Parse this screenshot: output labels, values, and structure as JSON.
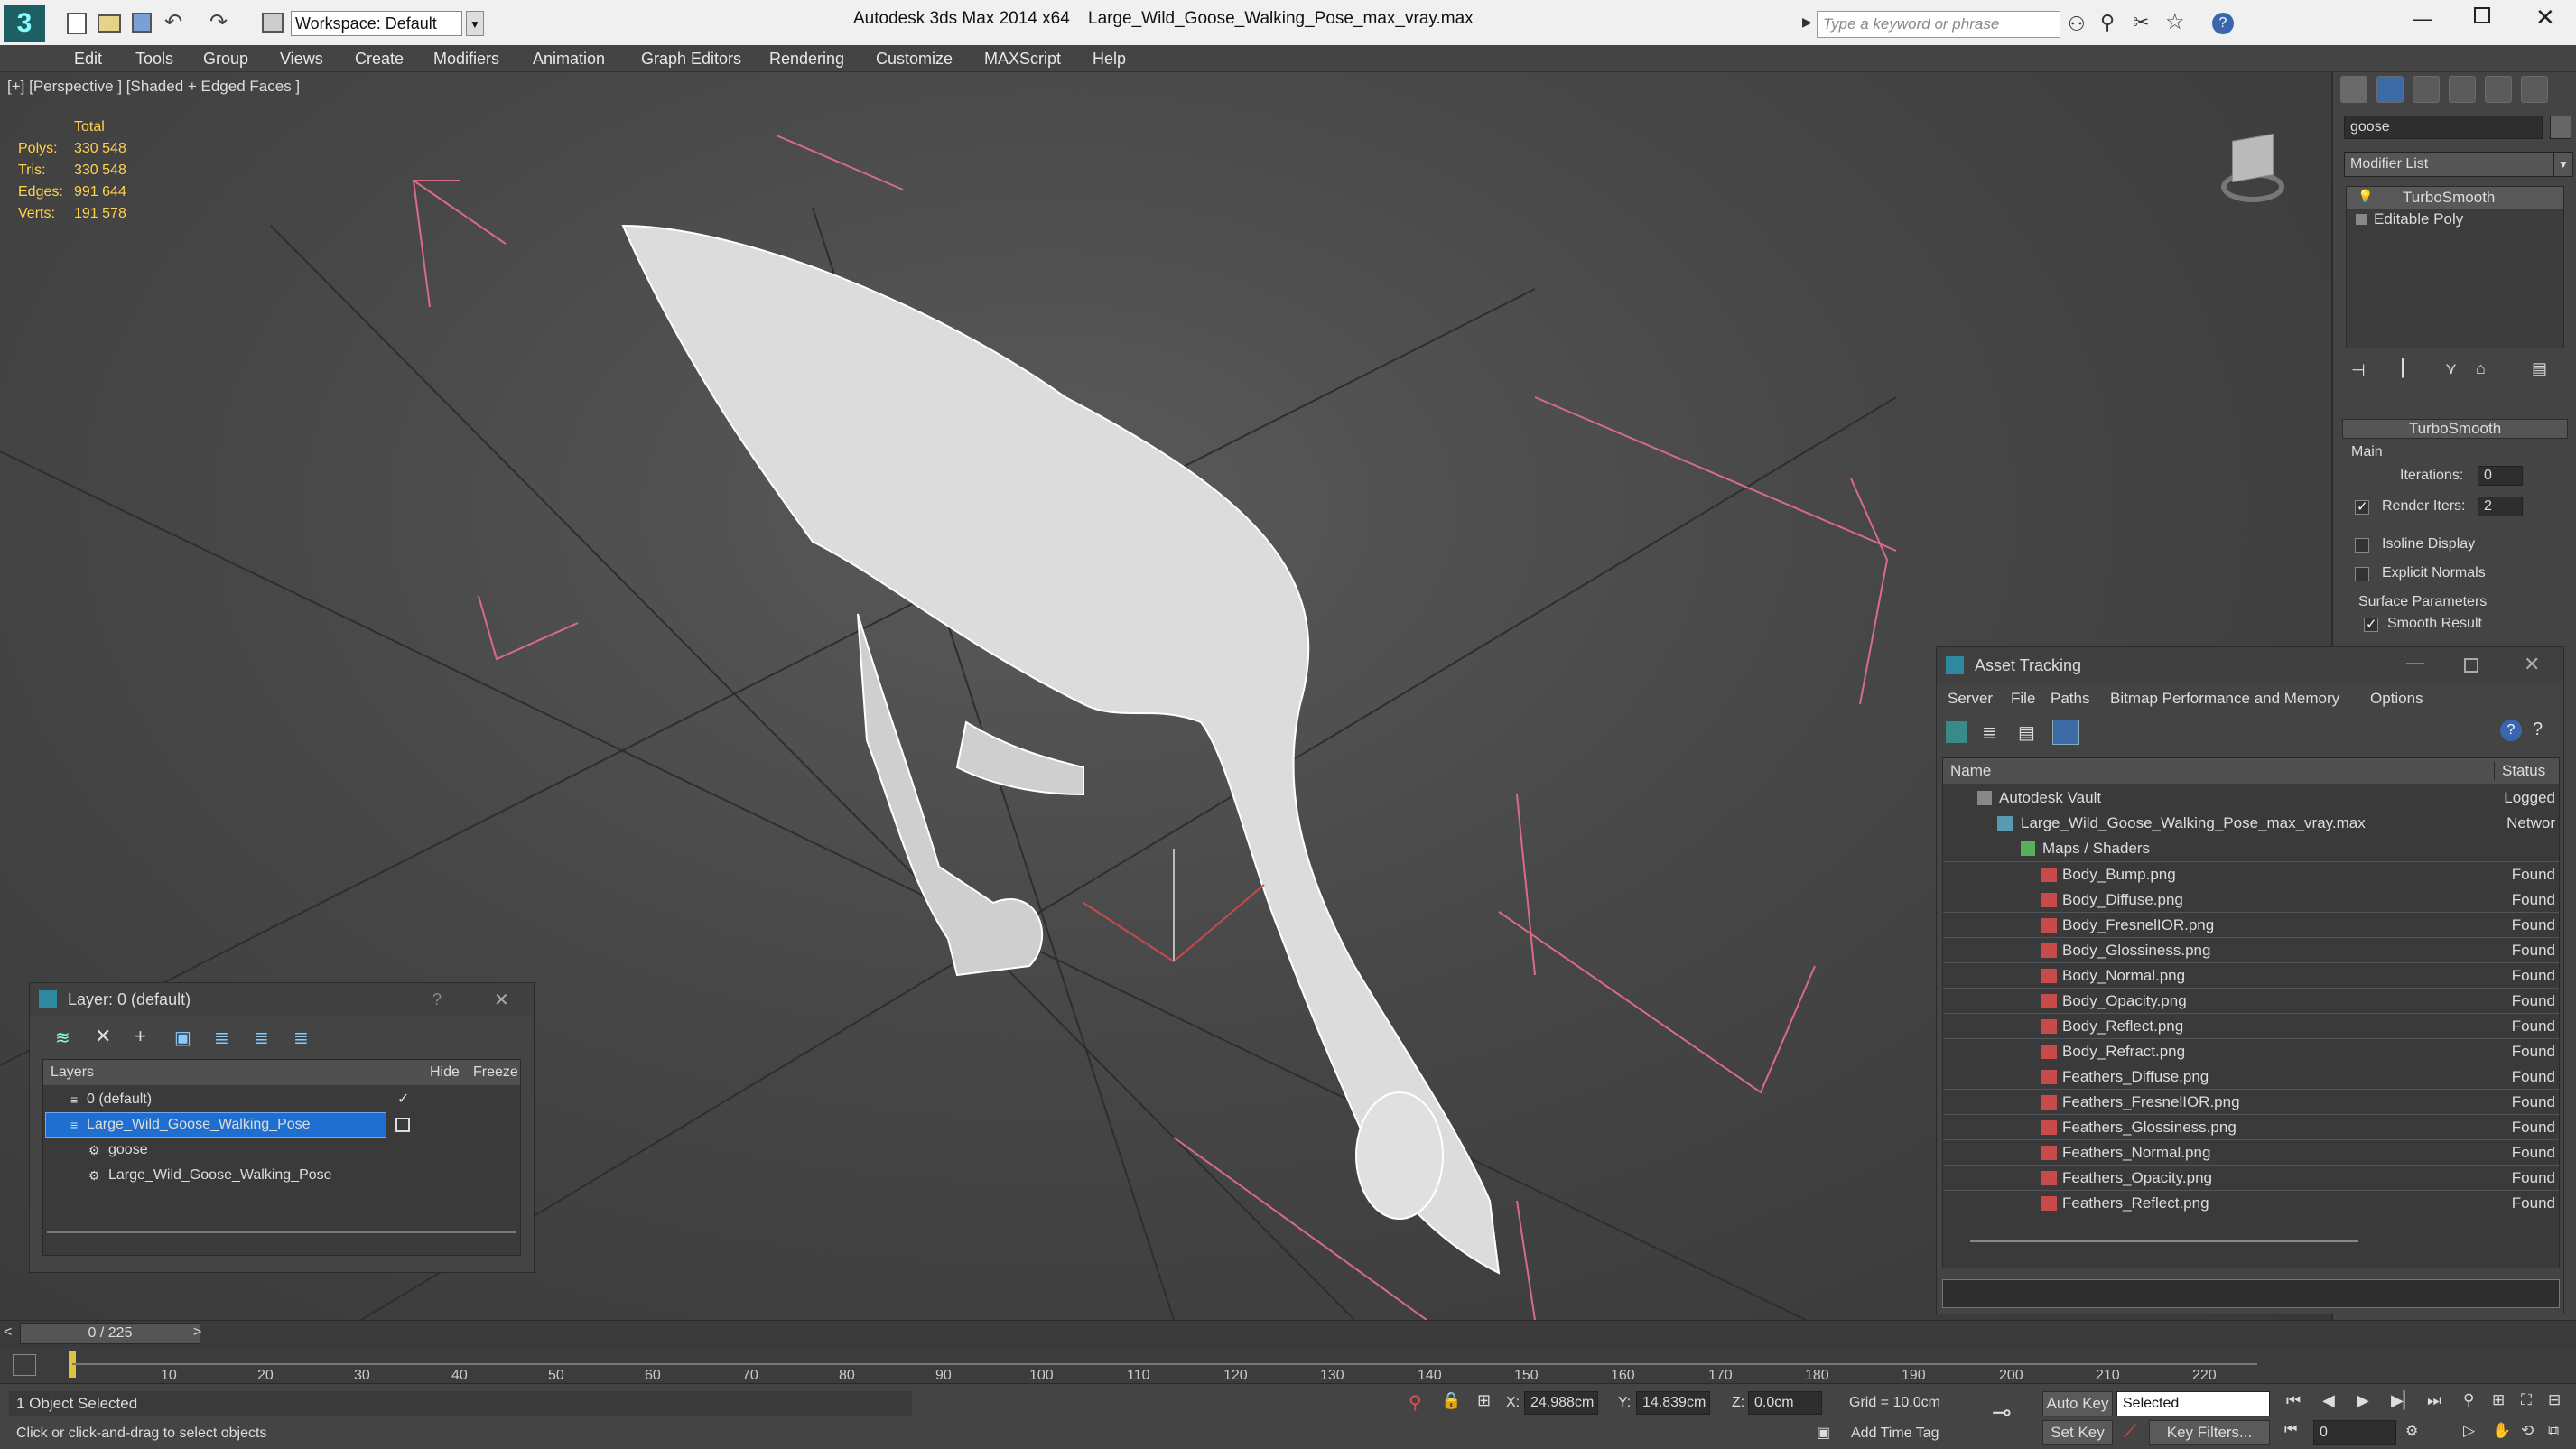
{
  "titlebar": {
    "app_title": "Autodesk 3ds Max  2014 x64",
    "file_title": "Large_Wild_Goose_Walking_Pose_max_vray.max",
    "workspace": "Workspace: Default",
    "search_placeholder": "Type a keyword or phrase"
  },
  "menu": [
    "Edit",
    "Tools",
    "Group",
    "Views",
    "Create",
    "Modifiers",
    "Animation",
    "Graph Editors",
    "Rendering",
    "Customize",
    "MAXScript",
    "Help"
  ],
  "viewport": {
    "label": "[+] [Perspective ] [Shaded + Edged Faces ]",
    "stats_header": "Total",
    "stats": [
      {
        "k": "Polys:",
        "v": "330 548"
      },
      {
        "k": "Tris:",
        "v": "330 548"
      },
      {
        "k": "Edges:",
        "v": "991 644"
      },
      {
        "k": "Verts:",
        "v": "191 578"
      }
    ]
  },
  "command_panel": {
    "object_name": "goose",
    "modifier_list": "Modifier List",
    "stack": [
      "TurboSmooth",
      "Editable Poly"
    ],
    "rollout_title": "TurboSmooth",
    "group_main": "Main",
    "iterations_label": "Iterations:",
    "iterations_value": "0",
    "render_iters_label": "Render Iters:",
    "render_iters_value": "2",
    "isoline_label": "Isoline Display",
    "explicit_normals_label": "Explicit Normals",
    "surface_params": "Surface Parameters",
    "smooth_result": "Smooth Result"
  },
  "layer_window": {
    "title": "Layer: 0 (default)",
    "help": "?",
    "col_layers": "Layers",
    "col_hide": "Hide",
    "col_freeze": "Freeze",
    "rows": [
      "0 (default)",
      "Large_Wild_Goose_Walking_Pose",
      "goose",
      "Large_Wild_Goose_Walking_Pose"
    ]
  },
  "asset_tracking": {
    "title": "Asset Tracking",
    "menu": [
      "Server",
      "File",
      "Paths",
      "Bitmap Performance and Memory",
      "Options"
    ],
    "col_name": "Name",
    "col_status": "Status",
    "rows": [
      {
        "name": "Autodesk Vault",
        "status": "Logged"
      },
      {
        "name": "Large_Wild_Goose_Walking_Pose_max_vray.max",
        "status": "Networ"
      },
      {
        "name": "Maps / Shaders",
        "status": ""
      },
      {
        "name": "Body_Bump.png",
        "status": "Found"
      },
      {
        "name": "Body_Diffuse.png",
        "status": "Found"
      },
      {
        "name": "Body_FresnelIOR.png",
        "status": "Found"
      },
      {
        "name": "Body_Glossiness.png",
        "status": "Found"
      },
      {
        "name": "Body_Normal.png",
        "status": "Found"
      },
      {
        "name": "Body_Opacity.png",
        "status": "Found"
      },
      {
        "name": "Body_Reflect.png",
        "status": "Found"
      },
      {
        "name": "Body_Refract.png",
        "status": "Found"
      },
      {
        "name": "Feathers_Diffuse.png",
        "status": "Found"
      },
      {
        "name": "Feathers_FresnelIOR.png",
        "status": "Found"
      },
      {
        "name": "Feathers_Glossiness.png",
        "status": "Found"
      },
      {
        "name": "Feathers_Normal.png",
        "status": "Found"
      },
      {
        "name": "Feathers_Opacity.png",
        "status": "Found"
      },
      {
        "name": "Feathers_Reflect.png",
        "status": "Found"
      }
    ]
  },
  "timeline": {
    "frame_counter": "0 / 225",
    "ticks": [
      "10",
      "20",
      "30",
      "40",
      "50",
      "60",
      "70",
      "80",
      "90",
      "100",
      "110",
      "120",
      "130",
      "140",
      "150",
      "160",
      "170",
      "180",
      "190",
      "200",
      "210",
      "220"
    ]
  },
  "statusbar": {
    "selection": "1 Object Selected",
    "prompt": "Click or click-and-drag to select objects",
    "x_label": "X:",
    "x_value": "24.988cm",
    "y_label": "Y:",
    "y_value": "14.839cm",
    "z_label": "Z:",
    "z_value": "0.0cm",
    "grid": "Grid = 10.0cm",
    "add_time_tag": "Add Time Tag",
    "auto_key": "Auto Key",
    "set_key": "Set Key",
    "key_mode": "Selected",
    "key_filters": "Key Filters...",
    "frame_field": "0"
  }
}
